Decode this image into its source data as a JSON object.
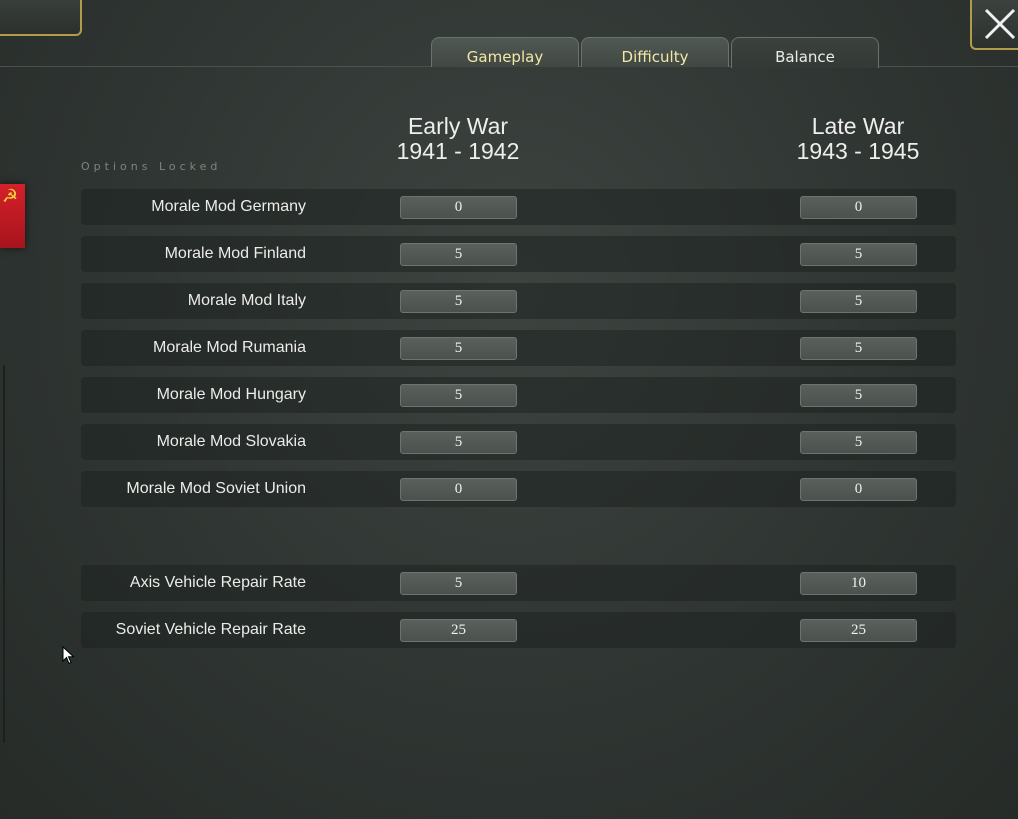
{
  "tabs": [
    {
      "label": "Gameplay"
    },
    {
      "label": "Difficulty"
    },
    {
      "label": "Balance"
    }
  ],
  "columns": {
    "early": {
      "title": "Early War",
      "range": "1941 - 1942"
    },
    "late": {
      "title": "Late War",
      "range": "1943 - 1945"
    }
  },
  "status": {
    "locked": "Options Locked"
  },
  "faction": {
    "icon": "hammer-sickle-icon",
    "color": "#c8182a"
  },
  "rows": [
    {
      "label": "Morale Mod Germany",
      "early": "0",
      "late": "0"
    },
    {
      "label": "Morale Mod Finland",
      "early": "5",
      "late": "5"
    },
    {
      "label": "Morale Mod Italy",
      "early": "5",
      "late": "5"
    },
    {
      "label": "Morale Mod Rumania",
      "early": "5",
      "late": "5"
    },
    {
      "label": "Morale Mod Hungary",
      "early": "5",
      "late": "5"
    },
    {
      "label": "Morale Mod Slovakia",
      "early": "5",
      "late": "5"
    },
    {
      "label": "Morale Mod Soviet Union",
      "early": "0",
      "late": "0"
    },
    {
      "label": "Axis Vehicle Repair Rate",
      "early": "5",
      "late": "10"
    },
    {
      "label": "Soviet Vehicle Repair Rate",
      "early": "25",
      "late": "25"
    }
  ],
  "colors": {
    "accent_gold": "#b39b4a",
    "tab_text": "#f2e8a6"
  }
}
